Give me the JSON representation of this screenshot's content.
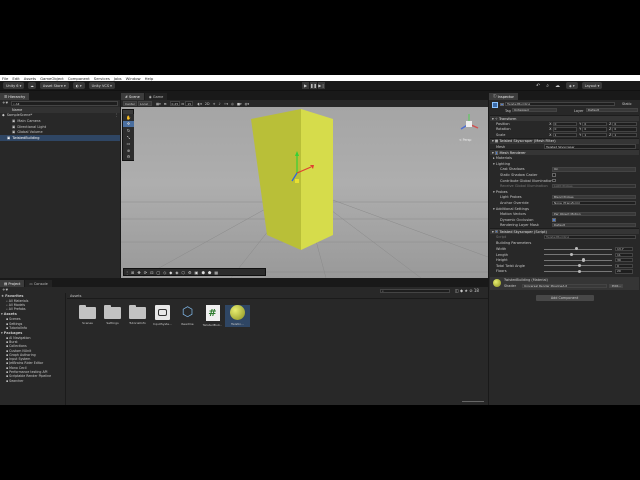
{
  "menubar": {
    "items": [
      "File",
      "Edit",
      "Assets",
      "GameObject",
      "Component",
      "Services",
      "Jobs",
      "Window",
      "Help"
    ]
  },
  "toolbar": {
    "account": "Unity 6",
    "asset_store": "Asset Store",
    "version_control": "Unity VCS",
    "layout": "Layout"
  },
  "hierarchy": {
    "tab": "Hierarchy",
    "search_placeholder": "All",
    "column": "Name",
    "items": [
      {
        "label": "SampleScene*",
        "depth": 0
      },
      {
        "label": "Main Camera",
        "depth": 2
      },
      {
        "label": "Directional Light",
        "depth": 2
      },
      {
        "label": "Global Volume",
        "depth": 2
      },
      {
        "label": "TwistedBuilding",
        "depth": 1
      }
    ]
  },
  "scene": {
    "tabs": [
      "Scene",
      "Game"
    ],
    "toolbar": {
      "center": "Center",
      "local": "Local",
      "snap": "0.25",
      "grid": "15",
      "persp": "< Persp"
    }
  },
  "project": {
    "tabs": [
      "Project",
      "Console"
    ],
    "favorites": {
      "label": "Favorites",
      "items": [
        "All Materials",
        "All Models",
        "All Prefabs"
      ]
    },
    "assets": {
      "label": "Assets",
      "items": [
        "Scenes",
        "Settings",
        "TutorialInfo"
      ]
    },
    "packages": {
      "label": "Packages",
      "items": [
        "AI Navigation",
        "Burst",
        "Collections",
        "Custom NUnit",
        "Graph Authoring",
        "Input System",
        "JetBrains Rider Editor",
        "Mono Cecil",
        "Performance testing API",
        "Scriptable Render Pipeline",
        "Searcher"
      ]
    },
    "breadcrumb": "Assets",
    "grid": [
      {
        "label": "Scenes",
        "kind": "folder"
      },
      {
        "label": "Settings",
        "kind": "folder"
      },
      {
        "label": "TutorialInfo",
        "kind": "folder"
      },
      {
        "label": "InputSyste...",
        "kind": "inputsys"
      },
      {
        "label": "Readme",
        "kind": "readme"
      },
      {
        "label": "TwistedBuil...",
        "kind": "script"
      },
      {
        "label": "Twistin...",
        "kind": "material"
      }
    ]
  },
  "inspector": {
    "tab": "Inspector",
    "object_name": "TwistedBuilding",
    "static_label": "Static",
    "tag_label": "Tag",
    "tag_value": "Untagged",
    "layer_label": "Layer",
    "layer_value": "Default",
    "transform": {
      "title": "Transform",
      "rows": [
        {
          "label": "Position",
          "x": "0",
          "y": "0",
          "z": "0"
        },
        {
          "label": "Rotation",
          "x": "0",
          "y": "0",
          "z": "0"
        },
        {
          "label": "Scale",
          "x": "1",
          "y": "1",
          "z": "1"
        }
      ]
    },
    "mesh_filter": {
      "title": "Twisted Skyscraper (Mesh Filter)",
      "mesh_label": "Mesh",
      "mesh_value": "Twisted Skyscraper"
    },
    "mesh_renderer": {
      "title": "Mesh Renderer",
      "materials": "Materials",
      "lighting": "Lighting",
      "cast_shadows": "Cast Shadows",
      "cast_shadows_value": "On",
      "static_shadow": "Static Shadow Caster",
      "contribute_gi": "Contribute Global Illumination",
      "receive_gi": "Receive Global Illumination",
      "receive_gi_value": "Light Probes",
      "probes": "Probes",
      "light_probes": "Light Probes",
      "light_probes_value": "Blend Probes",
      "anchor": "Anchor Override",
      "anchor_value": "None (Transform)",
      "additional": "Additional Settings",
      "motion": "Motion Vectors",
      "motion_value": "Per Object Motion",
      "dynamic_occlusion": "Dynamic Occlusion",
      "layer_mask": "Rendering Layer Mask",
      "layer_mask_value": "Default"
    },
    "script": {
      "title": "Twisted Skyscraper (Script)",
      "script_label": "Script",
      "script_value": "TwistedBuilding",
      "params": "Building Parameters",
      "sliders": [
        {
          "label": "Width",
          "value": "13.7",
          "fraction": 0.46
        },
        {
          "label": "Length",
          "value": "11",
          "fraction": 0.38
        },
        {
          "label": "Height",
          "value": "30",
          "fraction": 0.56
        },
        {
          "label": "Total Twist Angle",
          "value": "0",
          "fraction": 0.5
        },
        {
          "label": "Floors",
          "value": "20",
          "fraction": 0.5
        }
      ]
    },
    "material": {
      "title": "TwistedBuilding (Material)",
      "shader_label": "Shader",
      "shader_value": "Universal Render Pipeline/Lit",
      "edit": "Edit..."
    },
    "add_component": "Add Component"
  }
}
